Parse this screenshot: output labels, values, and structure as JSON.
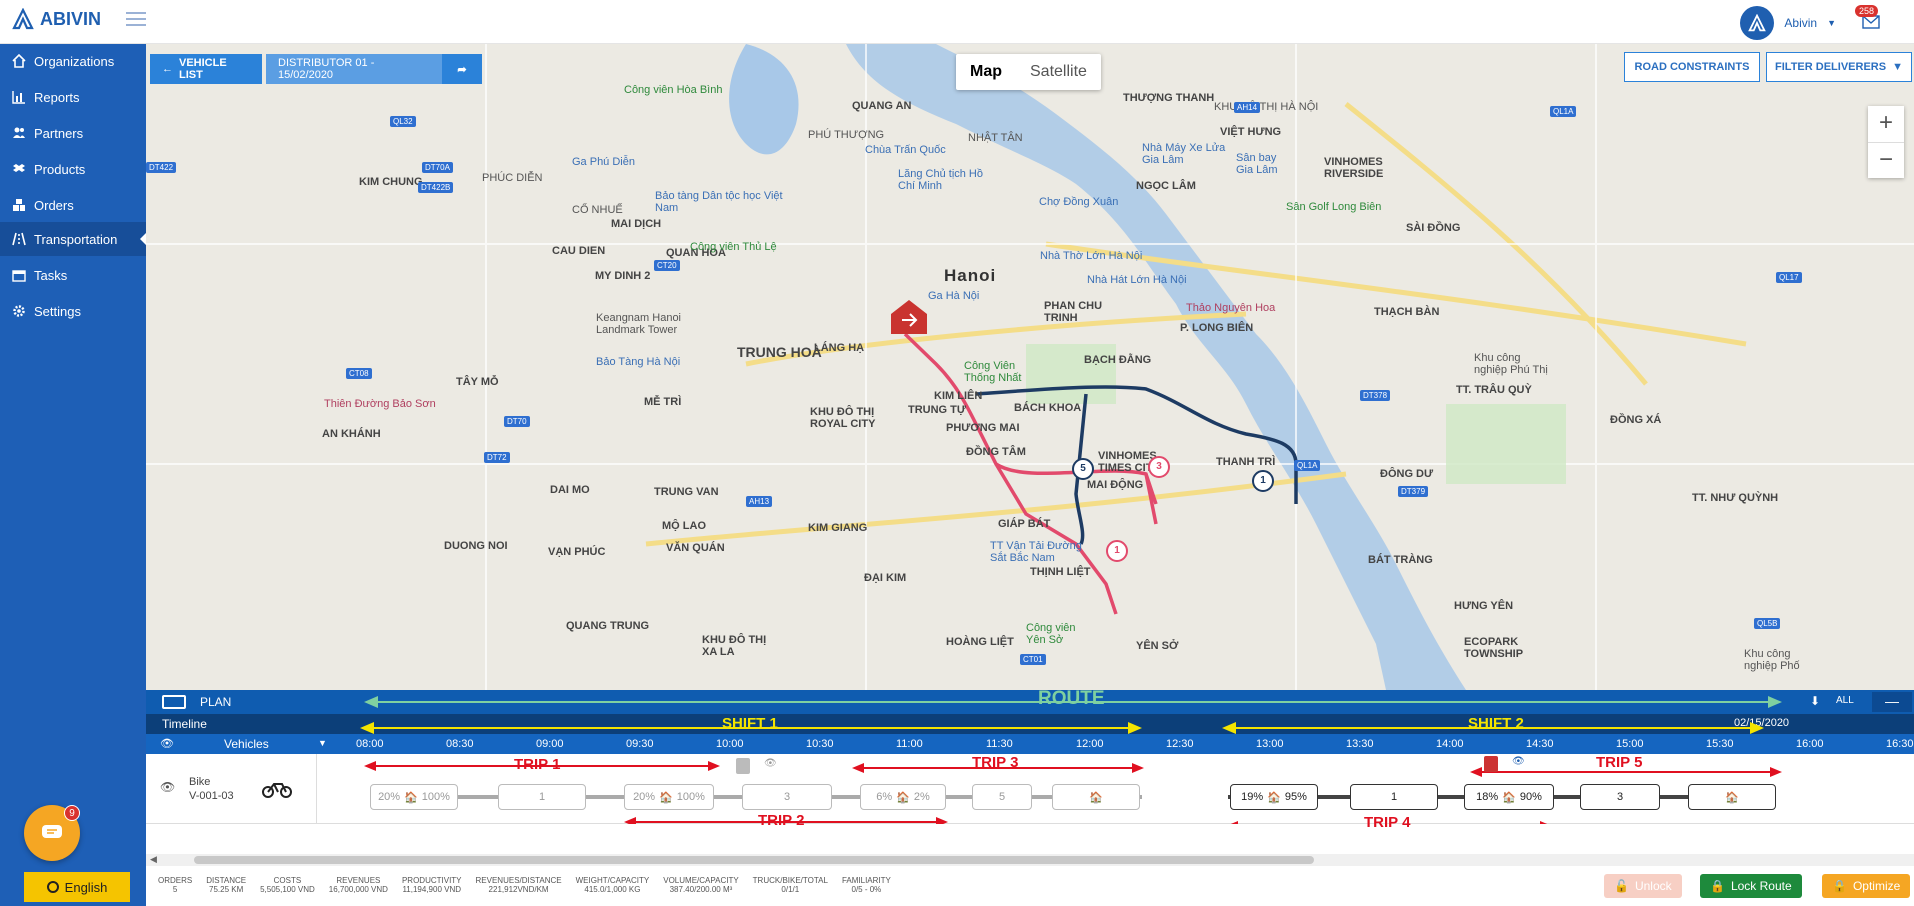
{
  "brand": {
    "name": "ABIVIN",
    "color": "#1f5fb0"
  },
  "user": {
    "name": "Abivin",
    "notifications": "258"
  },
  "sidebar": {
    "items": [
      {
        "label": "Organizations",
        "icon": "home-icon"
      },
      {
        "label": "Reports",
        "icon": "bar-chart-icon"
      },
      {
        "label": "Partners",
        "icon": "users-icon"
      },
      {
        "label": "Products",
        "icon": "dropbox-icon"
      },
      {
        "label": "Orders",
        "icon": "cubes-icon"
      },
      {
        "label": "Transportation",
        "icon": "road-icon",
        "active": true
      },
      {
        "label": "Tasks",
        "icon": "calendar-icon"
      },
      {
        "label": "Settings",
        "icon": "gear-icon"
      }
    ],
    "chat_badge": "9",
    "language": "English"
  },
  "map": {
    "vehicle_list": "VEHICLE LIST",
    "distributor": "DISTRIBUTOR 01 - 15/02/2020",
    "map_type": {
      "map": "Map",
      "satellite": "Satellite"
    },
    "road_constraints": "ROAD CONSTRAINTS",
    "filter_deliverers": "FILTER DELIVERERS",
    "labels": {
      "hanoi": "Hanoi",
      "trung_hoa": "TRUNG HOÀ",
      "quang_an": "QUANG AN",
      "phu_thuong": "PHÚ THƯỢNG",
      "nhat_tan": "NHẬT TÂN",
      "thuong_thanh": "THƯỢNG THANH",
      "khu_do_thi": "KHU ĐÔ THỊ HÀ NỘI",
      "viet_hung": "VIỆT HƯNG",
      "cong_vien_hoa_binh": "Công viên Hòa Bình",
      "ga_phu_dien": "Ga Phú Diễn",
      "kim_chung": "KIM CHUNG",
      "phuc_dien": "PHÚC DIỄN",
      "co_nhue": "CỔ NHUẾ",
      "mai_dich": "MAI DỊCH",
      "cau_dien": "CAU DIEN",
      "my_dinh_2": "MY DINH 2",
      "quan_hoa": "QUAN HOA",
      "bao_tang_dan_toc": "Bảo tàng Dân tộc học Việt Nam",
      "chua_tran_quoc": "Chùa Trấn Quốc",
      "lang_chu_tich": "Lăng Chủ tịch Hồ Chí Minh",
      "cho_dong_xuan": "Chợ Đồng Xuân",
      "cong_vien_thu_le": "Công viên Thủ Lệ",
      "ngoc_lam": "NGỌC LÂM",
      "nha_may_xe_lua": "Nhà Máy Xe Lửa Gia Lâm",
      "san_bay_gia_lam": "Sân bay Gia Lâm",
      "san_golf": "Sân Golf Long Biên",
      "vinhomes_riverside": "VINHOMES RIVERSIDE",
      "sai_dong": "SÀI ĐỒNG",
      "nha_tho": "Nhà Thờ Lớn Hà Nội",
      "nha_hat": "Nhà Hát Lớn Hà Nội",
      "phan_chu_trinh": "PHAN CHU TRINH",
      "thao_nguyen_hoa": "Thảo Nguyên Hoa",
      "p_long_bien": "P. LONG BIÊN",
      "thach_ban": "THẠCH BÀN",
      "ga_ha_noi": "Ga Hà Nội",
      "keangnam": "Keangnam Hanoi Landmark Tower",
      "lang_ha": "LÁNG HẠ",
      "bao_tang_ha_noi": "Bảo Tàng Hà Nội",
      "cong_vien_thong_nhat": "Công Viên Thống Nhất",
      "bach_dang": "BẠCH ĐẰNG",
      "khu_cong_nghiep": "Khu công nghiệp Phú Thị",
      "tay_mo": "TÂY MỖ",
      "thien_duong": "Thiên Đường Bảo Sơn",
      "me_tri": "MỄ TRÌ",
      "kim_lien": "KIM LIÊN",
      "bach_khoa": "BÁCH KHOA",
      "trung_tu": "TRUNG TỰ",
      "royal_city": "KHU ĐÔ THỊ ROYAL CITY",
      "phuong_mai": "PHƯƠNG MAI",
      "an_khanh": "AN KHÁNH",
      "dong_tam": "ĐỒNG TÂM",
      "vinhomes_times": "VINHOMES TIMES CITY",
      "mai_dong": "MAI ĐỘNG",
      "thanh_tri": "THANH TRÌ",
      "dong_du": "ĐÔNG DƯ",
      "tt_trau_quy": "TT. TRÂU QUỲ",
      "dong_xa": "ĐỒNG XÁ",
      "tt_nhu_quynh": "TT. NHƯ QUỲNH",
      "dai_mo": "DAI MO",
      "trung_van": "TRUNG VAN",
      "mo_lao": "MỘ LAO",
      "kim_giang": "KIM GIANG",
      "giap_bat": "GIÁP BÁT",
      "tt_van_tai": "TT Vận Tải Đường Sắt Bắc Nam",
      "thinh_liet": "THỊNH LIỆT",
      "duong_noi": "DUONG NOI",
      "van_phuc": "VẠN PHÚC",
      "van_quan": "VĂN QUÁN",
      "dai_kim": "ĐẠI KIM",
      "bat_trang": "BÁT TRÀNG",
      "hung_yen": "HƯNG YÊN",
      "quang_trung": "QUANG TRUNG",
      "khu_do_thi_xa_la": "KHU ĐÔ THỊ XA LA",
      "hoang_liet": "HOÀNG LIỆT",
      "cong_vien_yen_so": "Công viên Yên Sở",
      "yen_so": "YÊN SỞ",
      "ecopark": "ECOPARK TOWNSHIP",
      "khu_cong_nghiep_pho": "Khu công nghiệp Phố"
    },
    "road_tags": [
      "QL32",
      "DT422",
      "DT70A",
      "DT422B",
      "QL1A",
      "AH14",
      "QL17",
      "CT08",
      "DT70",
      "DT72",
      "CT20",
      "AH13",
      "DT379",
      "QL5B",
      "DT378",
      "CT01",
      "QL1A"
    ],
    "pins": [
      "1",
      "3",
      "5",
      "1"
    ]
  },
  "plan": {
    "title": "PLAN",
    "route_label": "ROUTE",
    "all_label": "ALL",
    "timeline_label": "Timeline",
    "vehicles_label": "Vehicles",
    "date": "02/15/2020",
    "shift1": "SHIFT 1",
    "shift2": "SHIFT 2",
    "hours": [
      "08:00",
      "08:30",
      "09:00",
      "09:30",
      "10:00",
      "10:30",
      "11:00",
      "11:30",
      "12:00",
      "12:30",
      "13:00",
      "13:30",
      "14:00",
      "14:30",
      "15:00",
      "15:30",
      "16:00",
      "16:30"
    ],
    "vehicle": {
      "type": "Bike",
      "id": "V-001-03"
    },
    "trips": [
      "TRIP 1",
      "TRIP 2",
      "TRIP 3",
      "TRIP 4",
      "TRIP 5"
    ],
    "stops": [
      {
        "pct_a": "20%",
        "pct_b": "100%"
      },
      {
        "value": "1"
      },
      {
        "pct_a": "20%",
        "pct_b": "100%"
      },
      {
        "value": "3"
      },
      {
        "pct_a": "6%",
        "pct_b": "2%"
      },
      {
        "value": "5"
      },
      {
        "pct_a": "",
        "pct_b": ""
      },
      {
        "pct_a": "19%",
        "pct_b": "95%"
      },
      {
        "value": "1"
      },
      {
        "pct_a": "18%",
        "pct_b": "90%"
      },
      {
        "value": "3"
      },
      {
        "pct_a": "",
        "pct_b": ""
      }
    ],
    "stats": [
      {
        "label": "ORDERS",
        "value": "5"
      },
      {
        "label": "DISTANCE",
        "value": "75.25 KM"
      },
      {
        "label": "COSTS",
        "value": "5,505,100 VND"
      },
      {
        "label": "REVENUES",
        "value": "16,700,000 VND"
      },
      {
        "label": "PRODUCTIVITY",
        "value": "11,194,900 VND"
      },
      {
        "label": "REVENUES/DISTANCE",
        "value": "221,912VND/KM"
      },
      {
        "label": "WEIGHT/CAPACITY",
        "value": "415.0/1,000 KG"
      },
      {
        "label": "VOLUME/CAPACITY",
        "value": "387.40/200.00 M³"
      },
      {
        "label": "TRUCK/BIKE/TOTAL",
        "value": "0/1/1"
      },
      {
        "label": "FAMILIARITY",
        "value": "0/5 - 0%"
      }
    ],
    "unlock": "Unlock",
    "lock_route": "Lock Route",
    "optimize": "Optimize"
  }
}
